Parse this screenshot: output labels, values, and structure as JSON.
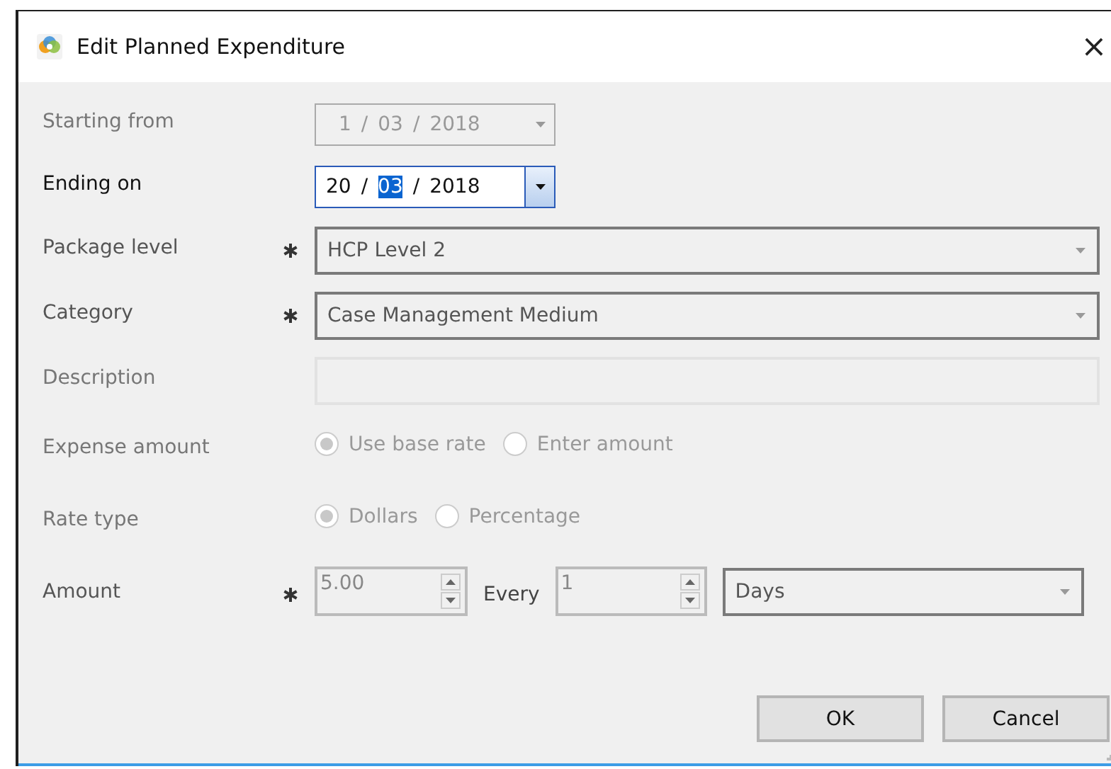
{
  "window": {
    "title": "Edit Planned Expenditure",
    "close": "×"
  },
  "rows": [
    {
      "kind": "date",
      "label": "Starting from",
      "disabled": true,
      "focused": false,
      "segments": [
        {
          "text": "1",
          "selected": false
        },
        {
          "text": "/",
          "selected": false
        },
        {
          "text": "03",
          "selected": false
        },
        {
          "text": "/",
          "selected": false
        },
        {
          "text": "2018",
          "selected": false
        }
      ]
    },
    {
      "kind": "date",
      "label": "Ending on",
      "disabled": false,
      "focused": true,
      "segments": [
        {
          "text": "20",
          "selected": false
        },
        {
          "text": "/",
          "selected": false
        },
        {
          "text": "03",
          "selected": true
        },
        {
          "text": "/",
          "selected": false
        },
        {
          "text": "2018",
          "selected": false
        }
      ]
    },
    {
      "kind": "combo",
      "label": "Package level",
      "required": true,
      "value": "HCP Level 2"
    },
    {
      "kind": "combo",
      "label": "Category",
      "required": true,
      "value": "Case Management Medium"
    },
    {
      "kind": "text",
      "label": "Description",
      "disabled": true
    },
    {
      "kind": "radio",
      "label": "Expense amount",
      "disabled": true,
      "options": [
        {
          "label": "Use base rate",
          "selected": true
        },
        {
          "label": "Enter amount",
          "selected": false
        }
      ]
    },
    {
      "kind": "radio",
      "label": "Rate type",
      "disabled": true,
      "options": [
        {
          "label": "Dollars",
          "selected": true
        },
        {
          "label": "Percentage",
          "selected": false
        }
      ]
    },
    {
      "kind": "amount",
      "label": "Amount",
      "required": true,
      "value": "5.00",
      "every": "Every",
      "interval": "1",
      "unit": "Days"
    }
  ],
  "buttons": [
    "OK",
    "Cancel"
  ]
}
